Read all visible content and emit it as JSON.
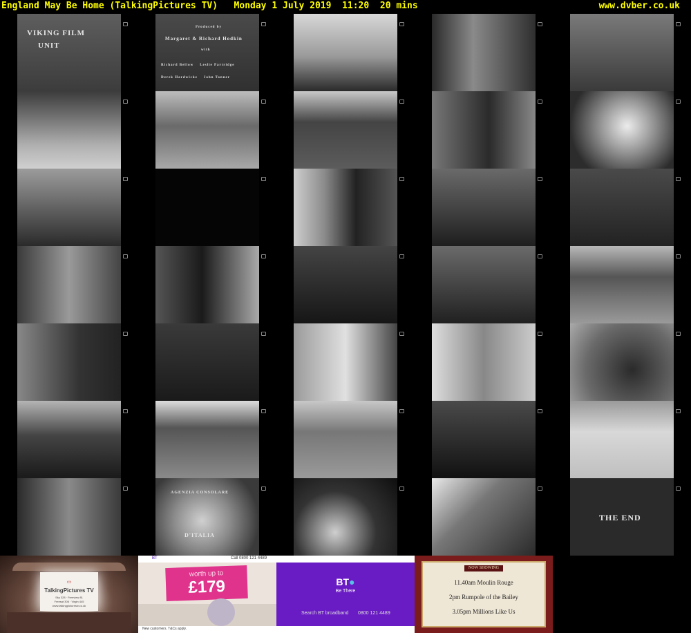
{
  "header": {
    "title": "England May Be Home (TalkingPictures TV)   Monday 1 July 2019  11:20  20 mins",
    "site": "www.dvber.co.uk"
  },
  "frames": [
    {
      "name": "frame-viking-film-unit",
      "lines": [
        "VIKING FILM",
        "UNIT"
      ]
    },
    {
      "name": "frame-credits-producers",
      "lines": [
        "Produced by",
        "Margaret & Richard Hodkin",
        "with",
        "Richard Bellow    Leslie Partridge",
        "Derek Hardwicke    John Tonner"
      ]
    },
    {
      "name": "frame-crane-cargo",
      "lines": []
    },
    {
      "name": "frame-street-workers",
      "lines": []
    },
    {
      "name": "frame-factory-machine",
      "lines": []
    },
    {
      "name": "frame-yard-figures",
      "lines": []
    },
    {
      "name": "frame-bus-road",
      "lines": []
    },
    {
      "name": "frame-lorry",
      "lines": []
    },
    {
      "name": "frame-men-by-wall",
      "lines": []
    },
    {
      "name": "frame-hands-photo",
      "lines": []
    },
    {
      "name": "frame-office-room",
      "lines": []
    },
    {
      "name": "frame-black",
      "lines": []
    },
    {
      "name": "frame-two-men-talking",
      "lines": []
    },
    {
      "name": "frame-man-at-desk",
      "lines": []
    },
    {
      "name": "frame-man-writing",
      "lines": []
    },
    {
      "name": "frame-street-men-walking",
      "lines": []
    },
    {
      "name": "frame-pub-conversation",
      "lines": []
    },
    {
      "name": "frame-pub-table",
      "lines": []
    },
    {
      "name": "frame-pub-bar",
      "lines": []
    },
    {
      "name": "frame-shopfront",
      "lines": []
    },
    {
      "name": "frame-crowd",
      "lines": []
    },
    {
      "name": "frame-group-men",
      "lines": []
    },
    {
      "name": "frame-shop-counter",
      "lines": []
    },
    {
      "name": "frame-shopkeeper-woman",
      "lines": []
    },
    {
      "name": "frame-items-table",
      "lines": []
    },
    {
      "name": "frame-radiogram",
      "lines": []
    },
    {
      "name": "frame-terrace-street",
      "lines": []
    },
    {
      "name": "frame-street-corner",
      "lines": []
    },
    {
      "name": "frame-handshake",
      "lines": []
    },
    {
      "name": "frame-model-house",
      "lines": []
    },
    {
      "name": "frame-doorway-men",
      "lines": []
    },
    {
      "name": "frame-consulate-plaque",
      "lines": [
        "AGENZIA CONSOLARE",
        "D'ITALIA"
      ]
    },
    {
      "name": "frame-hand-bottle",
      "lines": []
    },
    {
      "name": "frame-man-lattice",
      "lines": []
    },
    {
      "name": "frame-the-end",
      "lines": [
        "THE END"
      ]
    }
  ],
  "promos": {
    "talkingpictures": {
      "logo": "TalkingPictures TV",
      "line1": "Sky 328 · Freeview 81",
      "line2": "Freesat 306 · Virgin 445",
      "line3": "www.talkingpicturestv.co.uk"
    },
    "bt_offer": {
      "top_left": "BT",
      "top_right": "Call 0800 121 4489",
      "worth": "worth up to",
      "amount": "£179",
      "footer": "New customers. T&Cs apply."
    },
    "bt_brand": {
      "logo": "BT",
      "tagline": "Be There",
      "search": "Search BT broadband",
      "phone": "0800 121 4489"
    },
    "now_showing": {
      "heading": "NOW SHOWING",
      "items": [
        "11.40am Moulin Rouge",
        "2pm Rumpole of the Bailey",
        "3.05pm Millions Like Us"
      ]
    }
  }
}
